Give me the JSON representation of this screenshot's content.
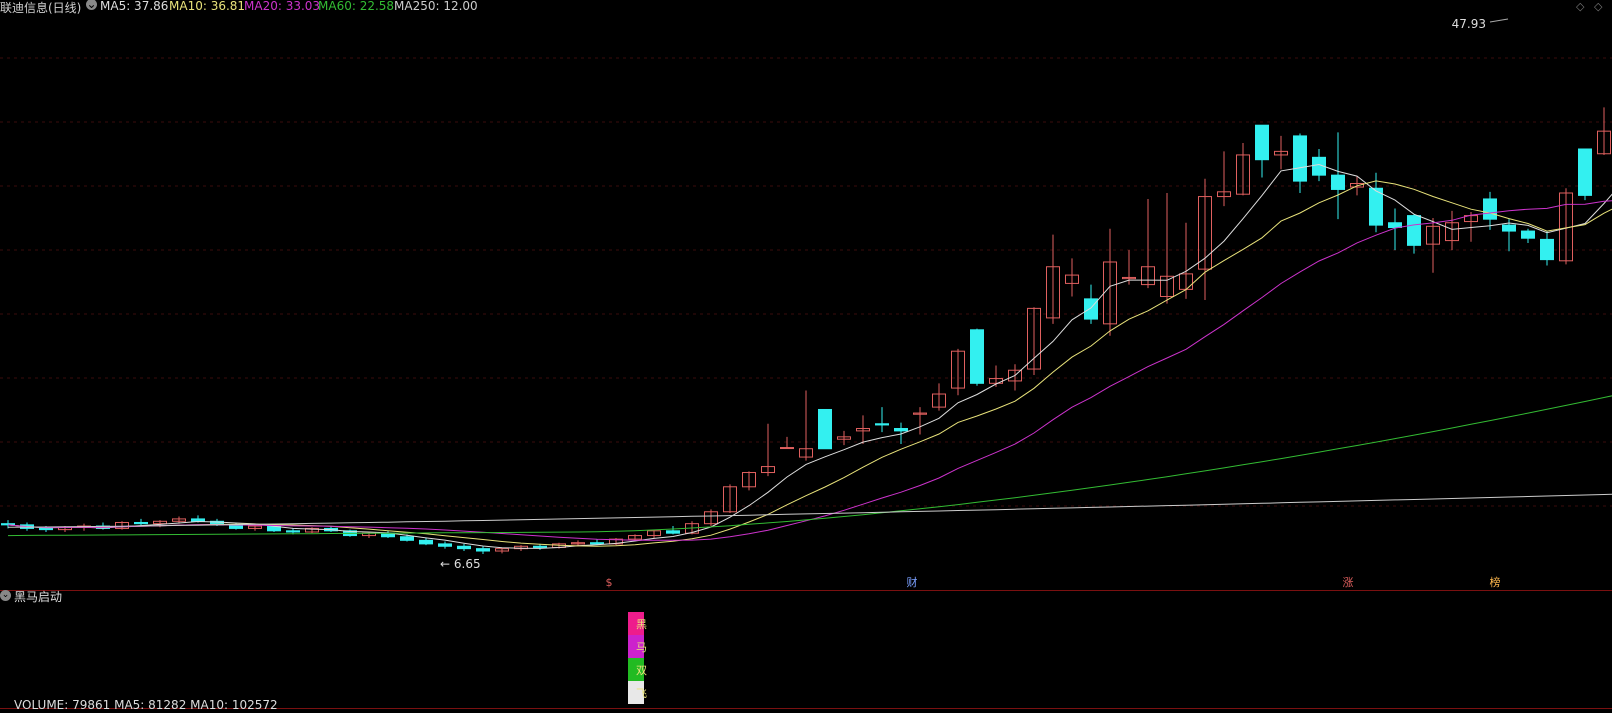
{
  "header": {
    "title": "联迪信息(日线)",
    "ma5": "MA5: 37.86",
    "ma10": "MA10: 36.81",
    "ma20": "MA20: 33.03",
    "ma60": "MA60: 22.58",
    "ma250": "MA250: 12.00"
  },
  "colors": {
    "up": "#e0605f",
    "down": "#33f0f0",
    "ma5": "#dddddd",
    "ma10": "#e8e27a",
    "ma20": "#cc33cc",
    "ma60": "#33bb33",
    "ma250": "#cccccc",
    "separator": "#7a1010",
    "grid": "#3a0c0c"
  },
  "icons": [
    "chevron-down-icon",
    "diamond-icon"
  ],
  "chart_data": {
    "type": "candlestick",
    "high_label": "47.93",
    "low_label": "6.65",
    "events": [
      {
        "label": "$",
        "color": "#e0605f"
      },
      {
        "label": "财",
        "color": "#7aa0ff"
      },
      {
        "label": "涨",
        "color": "#e0605f"
      },
      {
        "label": "榜",
        "color": "#ffb84d"
      }
    ],
    "ohlc": [
      [
        9.2,
        9.5,
        8.8,
        9.1
      ],
      [
        9.1,
        9.3,
        8.6,
        8.8
      ],
      [
        8.8,
        9.0,
        8.5,
        8.7
      ],
      [
        8.7,
        9.0,
        8.5,
        8.9
      ],
      [
        8.9,
        9.2,
        8.6,
        9.0
      ],
      [
        9.0,
        9.3,
        8.7,
        8.8
      ],
      [
        8.8,
        9.4,
        8.7,
        9.3
      ],
      [
        9.3,
        9.6,
        9.0,
        9.2
      ],
      [
        9.2,
        9.5,
        8.9,
        9.4
      ],
      [
        9.4,
        9.8,
        9.2,
        9.6
      ],
      [
        9.6,
        9.9,
        9.3,
        9.4
      ],
      [
        9.4,
        9.6,
        9.0,
        9.1
      ],
      [
        9.1,
        9.3,
        8.7,
        8.8
      ],
      [
        8.8,
        9.1,
        8.6,
        9.0
      ],
      [
        9.0,
        9.2,
        8.5,
        8.6
      ],
      [
        8.6,
        8.8,
        8.3,
        8.5
      ],
      [
        8.5,
        8.9,
        8.4,
        8.8
      ],
      [
        8.8,
        9.0,
        8.5,
        8.6
      ],
      [
        8.6,
        8.7,
        8.1,
        8.2
      ],
      [
        8.2,
        8.5,
        8.0,
        8.4
      ],
      [
        8.4,
        8.6,
        8.0,
        8.1
      ],
      [
        8.1,
        8.3,
        7.7,
        7.8
      ],
      [
        7.8,
        8.0,
        7.4,
        7.5
      ],
      [
        7.5,
        7.7,
        7.1,
        7.3
      ],
      [
        7.3,
        7.5,
        6.9,
        7.1
      ],
      [
        7.1,
        7.3,
        6.65,
        6.9
      ],
      [
        6.9,
        7.2,
        6.7,
        7.1
      ],
      [
        7.1,
        7.4,
        6.9,
        7.3
      ],
      [
        7.3,
        7.5,
        7.0,
        7.2
      ],
      [
        7.2,
        7.6,
        7.1,
        7.5
      ],
      [
        7.5,
        7.8,
        7.3,
        7.6
      ],
      [
        7.6,
        7.9,
        7.4,
        7.5
      ],
      [
        7.5,
        8.0,
        7.4,
        7.9
      ],
      [
        7.9,
        8.3,
        7.7,
        8.2
      ],
      [
        8.2,
        8.7,
        8.0,
        8.6
      ],
      [
        8.6,
        9.0,
        8.3,
        8.4
      ],
      [
        8.4,
        9.4,
        8.3,
        9.2
      ],
      [
        9.2,
        10.4,
        9.0,
        10.2
      ],
      [
        10.2,
        12.5,
        10.1,
        12.3
      ],
      [
        12.3,
        13.6,
        12.0,
        13.5
      ],
      [
        13.5,
        17.6,
        13.2,
        14.0
      ],
      [
        15.6,
        16.5,
        15.5,
        15.6
      ],
      [
        14.8,
        20.4,
        14.5,
        15.5
      ],
      [
        18.8,
        18.8,
        15.5,
        15.5
      ],
      [
        16.3,
        17.0,
        15.8,
        16.5
      ],
      [
        17.0,
        18.3,
        15.9,
        17.2
      ],
      [
        17.6,
        19.0,
        16.9,
        17.5
      ],
      [
        17.2,
        17.7,
        15.9,
        17.0
      ],
      [
        18.4,
        19.0,
        16.7,
        18.5
      ],
      [
        19.0,
        21.0,
        18.7,
        20.1
      ],
      [
        20.6,
        23.9,
        20.0,
        23.7
      ],
      [
        25.5,
        25.6,
        20.8,
        21.0
      ],
      [
        21.0,
        22.5,
        20.7,
        21.4
      ],
      [
        21.2,
        22.6,
        20.4,
        22.1
      ],
      [
        22.2,
        27.4,
        21.7,
        27.3
      ],
      [
        26.5,
        33.5,
        26.0,
        30.8
      ],
      [
        29.4,
        31.5,
        28.3,
        30.1
      ],
      [
        28.1,
        29.3,
        26.0,
        26.4
      ],
      [
        26.0,
        34.0,
        25.0,
        31.2
      ],
      [
        29.8,
        32.2,
        29.3,
        29.9
      ],
      [
        29.3,
        36.5,
        29.0,
        30.8
      ],
      [
        28.3,
        37.0,
        27.7,
        30.0
      ],
      [
        28.9,
        34.5,
        28.1,
        30.2
      ],
      [
        30.6,
        38.2,
        28.0,
        36.7
      ],
      [
        36.7,
        40.5,
        35.9,
        37.1
      ],
      [
        36.9,
        41.2,
        36.8,
        40.2
      ],
      [
        42.7,
        42.7,
        38.3,
        39.8
      ],
      [
        40.2,
        41.8,
        39.0,
        40.5
      ],
      [
        41.8,
        42.0,
        37.0,
        38.0
      ],
      [
        40.0,
        40.7,
        38.0,
        38.5
      ],
      [
        38.5,
        42.1,
        34.8,
        37.3
      ],
      [
        37.5,
        38.4,
        36.8,
        37.8
      ],
      [
        37.4,
        38.7,
        33.7,
        34.3
      ],
      [
        34.5,
        35.7,
        32.2,
        34.1
      ],
      [
        35.1,
        35.2,
        31.9,
        32.6
      ],
      [
        32.7,
        34.9,
        30.3,
        34.2
      ],
      [
        33.0,
        35.5,
        32.2,
        34.5
      ],
      [
        34.6,
        35.4,
        32.9,
        35.1
      ],
      [
        36.5,
        37.1,
        33.9,
        34.8
      ],
      [
        34.3,
        34.8,
        32.1,
        33.8
      ],
      [
        33.8,
        34.0,
        32.8,
        33.2
      ],
      [
        33.1,
        33.8,
        30.9,
        31.4
      ],
      [
        31.3,
        37.4,
        31.0,
        37.0
      ],
      [
        40.7,
        40.7,
        36.4,
        36.8
      ],
      [
        40.3,
        44.2,
        40.2,
        42.2
      ],
      [
        38.9,
        42.7,
        38.4,
        42.3
      ],
      [
        41.8,
        42.2,
        39.2,
        40.2
      ],
      [
        38.2,
        39.4,
        37.4,
        38.5
      ],
      [
        39.4,
        40.2,
        38.0,
        40.1
      ],
      [
        39.5,
        45.4,
        39.0,
        41.7
      ],
      [
        40.5,
        41.6,
        39.6,
        40.6
      ],
      [
        41.0,
        41.9,
        39.9,
        41.5
      ],
      [
        47.0,
        47.93,
        43.6,
        47.0
      ]
    ]
  },
  "indicator": {
    "title": "黑马启动",
    "chars": [
      "黑",
      "马",
      "双",
      "飞"
    ]
  },
  "volume": {
    "text": "VOLUME: 79861  MA5: 81282  MA10: 102572"
  }
}
